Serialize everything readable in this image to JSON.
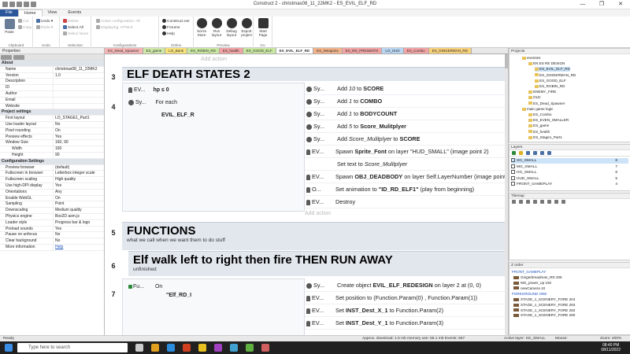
{
  "window": {
    "title": "Construct 2 - christmas08_11_22MK2 - ES_EVIL_ELF_RD",
    "controls": [
      "—",
      "❐",
      "✕"
    ]
  },
  "menu": [
    "File",
    "Home",
    "View",
    "Events"
  ],
  "ribbon": {
    "clipboard": {
      "label": "Clipboard",
      "paste": "Paste",
      "cut": "Cut",
      "copy": "Copy"
    },
    "undo": {
      "label": "Undo",
      "undo": "Undo ▾",
      "redo": "Redo ▾"
    },
    "selection": {
      "label": "Selection",
      "delete": "Delete",
      "select_all": "Select All",
      "select_none": "Select None"
    },
    "configs": {
      "label": "Configurations",
      "active": "Active configuration: All",
      "displaying": "Displaying: HTML5"
    },
    "online": {
      "label": "Online",
      "construct": "Construct.net",
      "forums": "Forums",
      "help": "Help"
    },
    "preview": {
      "label": "Preview",
      "scirra": "Scirra Store",
      "run": "Run layout",
      "debug": "Debug layout",
      "export": "Export project"
    },
    "go": {
      "label": "Go",
      "start": "Start Page"
    }
  },
  "properties": {
    "title": "Properties",
    "rows": [
      {
        "k": "About",
        "v": "",
        "cat": true
      },
      {
        "k": "Name",
        "v": "christmas08_11_22MK2"
      },
      {
        "k": "Version",
        "v": "1.0"
      },
      {
        "k": "Description",
        "v": ""
      },
      {
        "k": "ID",
        "v": ""
      },
      {
        "k": "Author",
        "v": ""
      },
      {
        "k": "Email",
        "v": ""
      },
      {
        "k": "Website",
        "v": ""
      },
      {
        "k": "Project settings",
        "v": "",
        "cat": true
      },
      {
        "k": "First layout",
        "v": "LO_STAGE1_Part1"
      },
      {
        "k": "Use loader layout",
        "v": "No"
      },
      {
        "k": "Pixel rounding",
        "v": "On"
      },
      {
        "k": "Preview effects",
        "v": "Yes"
      },
      {
        "k": "Window Size",
        "v": "160, 90"
      },
      {
        "k": "Width",
        "v": "160",
        "sub": true
      },
      {
        "k": "Height",
        "v": "90",
        "sub": true
      },
      {
        "k": "Configuration Settings",
        "v": "",
        "cat": true
      },
      {
        "k": "Preview browser",
        "v": "(default)"
      },
      {
        "k": "Fullscreen in browser",
        "v": "Letterbox integer scale"
      },
      {
        "k": "Fullscreen scaling",
        "v": "High quality"
      },
      {
        "k": "Use high-DPI display",
        "v": "Yes"
      },
      {
        "k": "Orientations",
        "v": "Any"
      },
      {
        "k": "Enable WebGL",
        "v": "On"
      },
      {
        "k": "Sampling",
        "v": "Point"
      },
      {
        "k": "Downscaling",
        "v": "Medium quality"
      },
      {
        "k": "Physics engine",
        "v": "Box2D asm.js"
      },
      {
        "k": "Loader style",
        "v": "Progress bar & logo"
      },
      {
        "k": "Preload sounds",
        "v": "Yes"
      },
      {
        "k": "Pause on unfocus",
        "v": "No"
      },
      {
        "k": "Clear background",
        "v": "No"
      },
      {
        "k": "More information",
        "v": "Help",
        "link": true
      }
    ]
  },
  "tabs": [
    {
      "label": "ES_Dead_Spawner",
      "color": "#f5b5b5"
    },
    {
      "label": "ES_game",
      "color": "#cfe8a8"
    },
    {
      "label": "LO_Bank",
      "color": "#f7e27a"
    },
    {
      "label": "ES_ROBIN_RD",
      "color": "#c9e7a0"
    },
    {
      "label": "ES_health",
      "color": "#f2a3a3"
    },
    {
      "label": "ES_GOOD_ELF",
      "color": "#c9e7a0"
    },
    {
      "label": "ES_EVIL_ELF_RD",
      "color": "#ffffff",
      "active": true
    },
    {
      "label": "ES_Weapons",
      "color": "#f2b38a"
    },
    {
      "label": "ES_RD_PRESENTS",
      "color": "#f2a3a3"
    },
    {
      "label": "LO_HUD",
      "color": "#b8d6f2"
    },
    {
      "label": "ES_Combo",
      "color": "#f2a3a3"
    },
    {
      "label": "ES_GINGERMAN_RD",
      "color": "#f7d07a"
    }
  ],
  "sheet": {
    "add_action": "Add action",
    "g3": {
      "num": "3",
      "title": "ELF DEATH STATES 2"
    },
    "e4": {
      "num": "4",
      "c1_obj": "EV...",
      "c1_text": "hp ≤ 0",
      "c2_obj": "Sy...",
      "c2_text": "For each",
      "c2_sub": "EVIL_ELF_R"
    },
    "actions4": [
      {
        "obj": "Sy...",
        "pre": "Add ",
        "it": "10",
        "mid": " to ",
        "b": "SCORE",
        "post": ""
      },
      {
        "obj": "Sy...",
        "pre": "Add ",
        "it": "1",
        "mid": " to ",
        "b": "COMBO",
        "post": ""
      },
      {
        "obj": "Sy...",
        "pre": "Add ",
        "it": "1",
        "mid": " to ",
        "b": "BODYCOUNT",
        "post": ""
      },
      {
        "obj": "Sy...",
        "pre": "Add ",
        "it": "5",
        "mid": " to ",
        "b": "Score_Mulitplyer",
        "post": ""
      },
      {
        "obj": "Sy...",
        "pre": "Add ",
        "it": "Score_Mulitplyer",
        "mid": " to ",
        "b": "SCORE",
        "post": ""
      },
      {
        "obj": "EV...",
        "pre": "Spawn ",
        "it": "",
        "mid": "",
        "b": "Sprite_Font",
        "post": " on layer \"HUD_SMALL\" (image point 2)"
      },
      {
        "obj": "",
        "pre": "Set text to ",
        "it": "Score_Mulitplyer",
        "mid": "",
        "b": "",
        "post": ""
      },
      {
        "obj": "EV...",
        "pre": "Spawn ",
        "it": "",
        "mid": "",
        "b": "OBJ_DEADBODY",
        "post": " on layer Self.LayerNumber (image point 0)"
      },
      {
        "obj": "O...",
        "pre": "Set animation to ",
        "it": "",
        "mid": "",
        "b": "\"ID_RD_ELF1\"",
        "post": " (play from beginning)"
      },
      {
        "obj": "EV...",
        "pre": "Destroy",
        "it": "",
        "mid": "",
        "b": "",
        "post": ""
      }
    ],
    "g5": {
      "num": "5",
      "title": "FUNCTIONS",
      "desc": "what we call when we want them to do stuff"
    },
    "g6": {
      "num": "6",
      "title": "Elf walk left to right then fire THEN RUN AWAY",
      "desc": "unfinished"
    },
    "e7": {
      "num": "7",
      "c1_obj": "Fu...",
      "c1_text": "On",
      "c1_sub": "\"Elf_RD_I"
    },
    "actions7": [
      {
        "obj": "Sy...",
        "pre": "Create object ",
        "b": "EVIL_ELF_REDESIGN",
        "post": " on layer 2 at (0, 0)"
      },
      {
        "obj": "EV...",
        "pre": "Set position to (",
        "b": "",
        "post": "Function.Param(0) , Function.Param(1))"
      },
      {
        "obj": "EV...",
        "pre": "Set ",
        "b": "INST_Dest_X_1",
        "post": " to Function.Param(2)"
      },
      {
        "obj": "EV...",
        "pre": "Set ",
        "b": "INST_Dest_Y_1",
        "post": " to Function.Param(3)"
      }
    ]
  },
  "projects": {
    "title": "Projects",
    "items": [
      {
        "t": "enemies",
        "d": 0
      },
      {
        "t": "EN ES RE DESIGN",
        "d": 1
      },
      {
        "t": "ES_EVIL_ELF_RD",
        "d": 2,
        "sel": true
      },
      {
        "t": "ES_GINGERMAN_RD",
        "d": 2
      },
      {
        "t": "ES_GOOD_ELF",
        "d": 2
      },
      {
        "t": "ES_ROBIN_RD",
        "d": 2
      },
      {
        "t": "ENEMY_FIRE",
        "d": 1
      },
      {
        "t": "OLD",
        "d": 1
      },
      {
        "t": "ES_Dead_Spawner",
        "d": 1
      },
      {
        "t": "main game logic",
        "d": 0
      },
      {
        "t": "ES_Combo",
        "d": 1
      },
      {
        "t": "ES_EVEN_SMALLER",
        "d": 1
      },
      {
        "t": "ES_game",
        "d": 1
      },
      {
        "t": "ES_health",
        "d": 1
      },
      {
        "t": "ES_Stage1_Part1",
        "d": 1
      }
    ]
  },
  "layers": {
    "title": "Layers",
    "rows": [
      {
        "n": "SG_SMALL",
        "v": "8",
        "sel": true
      },
      {
        "n": "MG_SMALL",
        "v": "7"
      },
      {
        "n": "HG_SMALL",
        "v": "6"
      },
      {
        "n": "HUD_SMALL",
        "v": "5"
      },
      {
        "n": "FRONT_GAMEPLAY",
        "v": "4"
      }
    ]
  },
  "tilemap": {
    "title": "Tilemap"
  },
  "zorder": {
    "title": "Z order",
    "g1": "FRONT_GAMEPLAY",
    "i1": [
      "Gingerbreadman_RD 206",
      "MG_power_up 192",
      "newCamera 10"
    ],
    "g2": "FOREGROUND ONE",
    "i2": [
      "STAGE_1_SCENERY_FORE 204",
      "STAGE_1_SCENERY_FORE 293",
      "STAGE_1_SCENERY_FORE 292",
      "STAGE_1_SCENERY_FORE 290"
    ]
  },
  "status": {
    "left": "Ready",
    "mid": "Approx. download: 1.5 mb  memory use: 56.1 mb  Events: 567",
    "layer": "Active layer: SG_SMALL",
    "mouse": "Mouse:",
    "zoom": "Zoom: 400%"
  },
  "taskbar": {
    "search": "Type here to search",
    "time": "08:40 PM",
    "date": "08/11/2022"
  }
}
